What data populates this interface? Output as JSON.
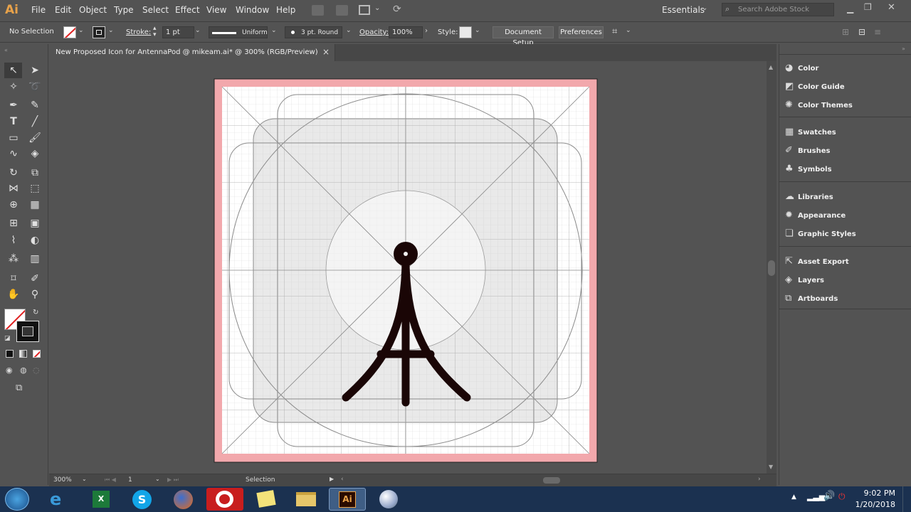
{
  "app": {
    "logo": "Ai"
  },
  "menu": [
    "File",
    "Edit",
    "Object",
    "Type",
    "Select",
    "Effect",
    "View",
    "Window",
    "Help"
  ],
  "workspace": {
    "label": "Essentials",
    "search_placeholder": "Search Adobe Stock"
  },
  "control": {
    "selection": "No Selection",
    "stroke_label": "Stroke:",
    "stroke_weight": "1 pt",
    "profile": "Uniform",
    "brush": "3 pt. Round",
    "opacity_label": "Opacity:",
    "opacity_value": "100%",
    "style_label": "Style:",
    "document_setup": "Document Setup",
    "preferences": "Preferences"
  },
  "document": {
    "tab_title": "New Proposed Icon for AntennaPod @ mikeam.ai* @ 300% (RGB/Preview)",
    "close": "×"
  },
  "status": {
    "zoom": "300%",
    "artboard": "1",
    "tool": "Selection"
  },
  "panels": [
    {
      "label": "Color",
      "icon": "color-icon"
    },
    {
      "label": "Color Guide",
      "icon": "color-guide-icon"
    },
    {
      "label": "Color Themes",
      "icon": "color-themes-icon"
    },
    {
      "label": "Swatches",
      "icon": "swatches-icon"
    },
    {
      "label": "Brushes",
      "icon": "brushes-icon"
    },
    {
      "label": "Symbols",
      "icon": "symbols-icon"
    },
    {
      "label": "Libraries",
      "icon": "libraries-icon"
    },
    {
      "label": "Appearance",
      "icon": "appearance-icon"
    },
    {
      "label": "Graphic Styles",
      "icon": "graphic-styles-icon"
    },
    {
      "label": "Asset Export",
      "icon": "asset-export-icon"
    },
    {
      "label": "Layers",
      "icon": "layers-icon"
    },
    {
      "label": "Artboards",
      "icon": "artboards-icon"
    }
  ],
  "taskbar": {
    "time": "9:02 PM",
    "date": "1/20/2018"
  },
  "colors": {
    "accent": "#e8a24a",
    "bleed": "#f2a8ac",
    "antenna": "#1a0606",
    "taskbar": "#1b3150"
  }
}
